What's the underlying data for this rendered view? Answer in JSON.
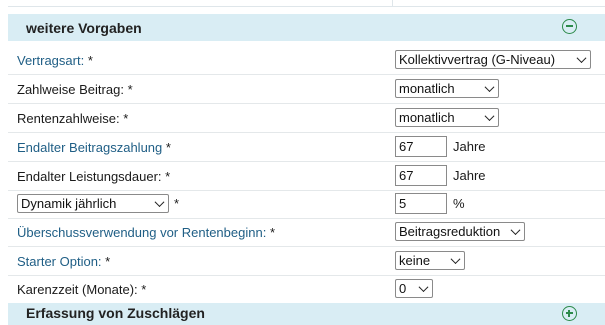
{
  "section": {
    "title": "weitere Vorgaben"
  },
  "rows": {
    "vertragsart": {
      "label": "Vertragsart:",
      "req": "*",
      "value": "Kollektivvertrag (G-Niveau)"
    },
    "zahlweise": {
      "label": "Zahlweise Beitrag:",
      "req": "*",
      "value": "monatlich"
    },
    "rentenzahlweise": {
      "label": "Rentenzahlweise:",
      "req": "*",
      "value": "monatlich"
    },
    "endalter_beitrag": {
      "label": "Endalter Beitragszahlung",
      "req": "*",
      "value": "67",
      "unit": "Jahre"
    },
    "endalter_leistung": {
      "label": "Endalter Leistungsdauer:",
      "req": "*",
      "value": "67",
      "unit": "Jahre"
    },
    "dynamik": {
      "select_value": "Dynamik jährlich",
      "req": "*",
      "value": "5",
      "unit": "%"
    },
    "ueberschuss": {
      "label": "Überschussverwendung vor Rentenbeginn:",
      "req": "*",
      "value": "Beitragsreduktion"
    },
    "starter": {
      "label": "Starter Option:",
      "req": "*",
      "value": "keine"
    },
    "karenz": {
      "label": "Karenzzeit (Monate):",
      "req": "*",
      "value": "0"
    }
  },
  "next_section": {
    "title": "Erfassung von Zuschlägen"
  },
  "colors": {
    "header_bg": "#d9edf4",
    "link_label": "#1f5e85",
    "toggle": "#2c8a4a"
  }
}
